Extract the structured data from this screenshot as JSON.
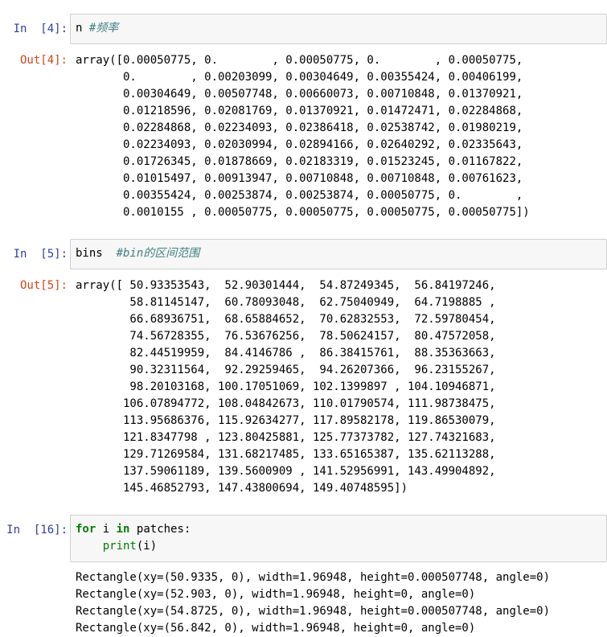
{
  "cells": [
    {
      "in_prompt": "In  [4]:",
      "code": {
        "var": "n",
        "comment": "#频率"
      },
      "out_prompt": "Out[4]:",
      "output_lines": [
        "array([0.00050775, 0.        , 0.00050775, 0.        , 0.00050775,",
        "       0.        , 0.00203099, 0.00304649, 0.00355424, 0.00406199,",
        "       0.00304649, 0.00507748, 0.00660073, 0.00710848, 0.01370921,",
        "       0.01218596, 0.02081769, 0.01370921, 0.01472471, 0.02284868,",
        "       0.02284868, 0.02234093, 0.02386418, 0.02538742, 0.01980219,",
        "       0.02234093, 0.02030994, 0.02894166, 0.02640292, 0.02335643,",
        "       0.01726345, 0.01878669, 0.02183319, 0.01523245, 0.01167822,",
        "       0.01015497, 0.00913947, 0.00710848, 0.00710848, 0.00761623,",
        "       0.00355424, 0.00253874, 0.00253874, 0.00050775, 0.        ,",
        "       0.0010155 , 0.00050775, 0.00050775, 0.00050775, 0.00050775])"
      ]
    },
    {
      "in_prompt": "In  [5]:",
      "code": {
        "var": "bins",
        "comment": "#bin的区间范围"
      },
      "out_prompt": "Out[5]:",
      "output_lines": [
        "array([ 50.93353543,  52.90301444,  54.87249345,  56.84197246,",
        "        58.81145147,  60.78093048,  62.75040949,  64.7198885 ,",
        "        66.68936751,  68.65884652,  70.62832553,  72.59780454,",
        "        74.56728355,  76.53676256,  78.50624157,  80.47572058,",
        "        82.44519959,  84.4146786 ,  86.38415761,  88.35363663,",
        "        90.32311564,  92.29259465,  94.26207366,  96.23155267,",
        "        98.20103168, 100.17051069, 102.1399897 , 104.10946871,",
        "       106.07894772, 108.04842673, 110.01790574, 111.98738475,",
        "       113.95686376, 115.92634277, 117.89582178, 119.86530079,",
        "       121.8347798 , 123.80425881, 125.77373782, 127.74321683,",
        "       129.71269584, 131.68217485, 133.65165387, 135.62113288,",
        "       137.59061189, 139.5600909 , 141.52956991, 143.49904892,",
        "       145.46852793, 147.43800694, 149.40748595])"
      ]
    },
    {
      "in_prompt": "In  [16]:",
      "code": {
        "kw_for": "for",
        "loop_var": "i",
        "kw_in": "in",
        "iterable": "patches:",
        "func": "print",
        "args": "(i)"
      },
      "output_lines": [
        "Rectangle(xy=(50.9335, 0), width=1.96948, height=0.000507748, angle=0)",
        "Rectangle(xy=(52.903, 0), width=1.96948, height=0, angle=0)",
        "Rectangle(xy=(54.8725, 0), width=1.96948, height=0.000507748, angle=0)",
        "Rectangle(xy=(56.842, 0), width=1.96948, height=0, angle=0)"
      ]
    }
  ]
}
